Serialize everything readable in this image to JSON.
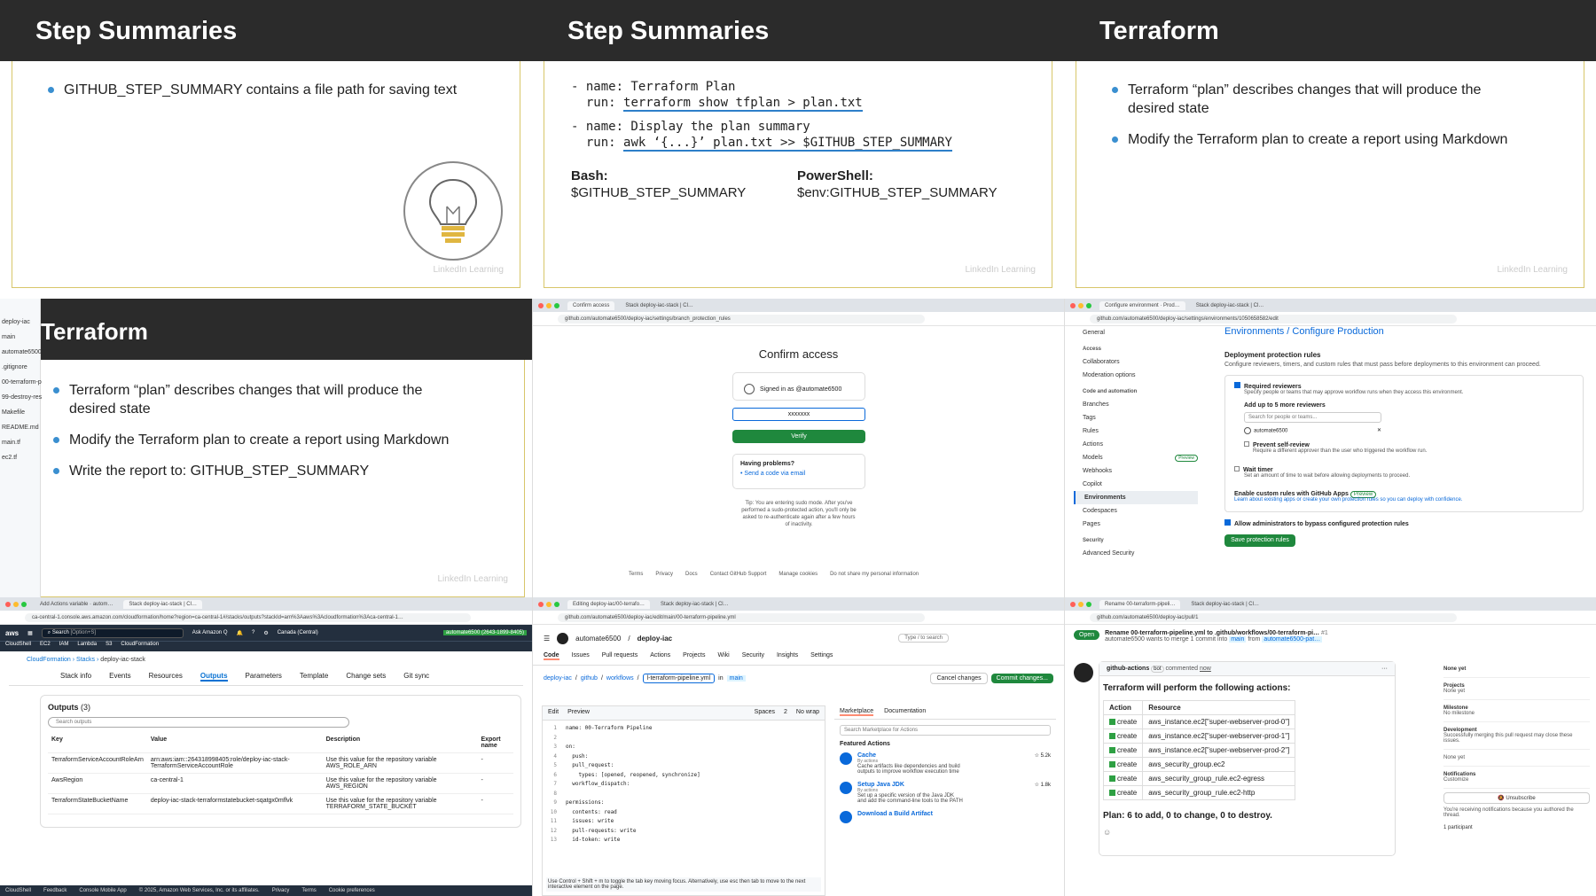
{
  "p1": {
    "title": "Step Summaries",
    "bullets": [
      "GITHUB_STEP_SUMMARY contains a file path for saving text"
    ]
  },
  "p2": {
    "title": "Step Summaries",
    "code": [
      [
        "- name: Terraform Plan",
        "  run: ",
        "terraform show tfplan > plan.txt"
      ],
      [
        "- name: Display the plan summary",
        "  run: ",
        "awk ‘{...}’ plan.txt >> $GITHUB_STEP_SUMMARY"
      ]
    ],
    "bash_label": "Bash:",
    "bash_value": "$GITHUB_STEP_SUMMARY",
    "ps_label": "PowerShell:",
    "ps_value": "$env:GITHUB_STEP_SUMMARY"
  },
  "p3": {
    "title": "Terraform",
    "bullets": [
      "Terraform “plan” describes changes that will produce the desired state",
      "Modify the Terraform plan to create a report using Markdown"
    ]
  },
  "p4": {
    "title": "Terraform",
    "bullets": [
      "Terraform “plan” describes changes that will produce the desired state",
      "Modify the Terraform plan to create a report using Markdown",
      "Write the report to: GITHUB_STEP_SUMMARY"
    ],
    "left_items": [
      "deploy-iac",
      "main",
      "automate6500",
      ".gitignore",
      "00-terraform-p",
      "99-destroy-res",
      "Makefile",
      "README.md",
      "main.tf",
      "ec2.tf"
    ]
  },
  "p5": {
    "tab": "Confirm access",
    "tab2": "Stack deploy-iac-stack | Cl…",
    "url": "github.com/automate6500/deploy-iac/settings/branch_protection_rules",
    "heading": "Confirm access",
    "signed_in": "Signed in as @automate6500",
    "password": "xxxxxxx",
    "verify": "Verify",
    "problems": "Having problems?",
    "send_code": "Send a code via email",
    "tip": "Tip: You are entering sudo mode. After you've performed a sudo-protected action, you'll only be asked to re-authenticate again after a few hours of inactivity.",
    "footer": [
      "Terms",
      "Privacy",
      "Docs",
      "Contact GitHub Support",
      "Manage cookies",
      "Do not share my personal information"
    ]
  },
  "p6": {
    "tab": "Configure environment · Prod…",
    "tab2": "Stack deploy-iac-stack | Cl…",
    "url": "github.com/automate6500/deploy-iac/settings/environments/1050658582/edit",
    "breadcrumb": "Environments / Configure Production",
    "sidebar": [
      "General",
      "Access",
      "Collaborators",
      "Moderation options",
      "Code and automation",
      "Branches",
      "Tags",
      "Rules",
      "Actions",
      "Models",
      "Webhooks",
      "Copilot",
      "Environments",
      "Codespaces",
      "Pages",
      "Security",
      "Advanced Security"
    ],
    "rules_title": "Deployment protection rules",
    "rules_desc": "Configure reviewers, timers, and custom rules that must pass before deployments to this environment can proceed.",
    "req_reviewers": "Required reviewers",
    "req_desc": "Specify people or teams that may approve workflow runs when they access this environment.",
    "add_more": "Add up to 5 more reviewers",
    "search_ph": "Search for people or teams...",
    "reviewer": "automate6500",
    "self_review": "Prevent self-review",
    "self_desc": "Require a different approver than the user who triggered the workflow run.",
    "wait": "Wait timer",
    "wait_desc": "Set an amount of time to wait before allowing deployments to proceed.",
    "custom": "Enable custom rules with GitHub Apps",
    "preview": "Preview",
    "custom_desc": "Learn about existing apps or create your own protection rules so you can deploy with confidence.",
    "bypass": "Allow administrators to bypass configured protection rules",
    "save": "Save protection rules"
  },
  "p7": {
    "tab": "Add Actions variable · autom…",
    "tab2": "Stack deploy-iac-stack | Cl…",
    "url": "ca-central-1.console.aws.amazon.com/cloudformation/home?region=ca-central-1#/stacks/outputs?stackId=arn%3Aaws%3Acloudformation%3Aca-central-1…",
    "search": "Search",
    "search_hint": "[Option+S]",
    "ask": "Ask Amazon Q",
    "region": "Canada (Central)",
    "account": "automate6500 (2643-1899-8405)",
    "console": "console",
    "services": [
      "CloudShell",
      "EC2",
      "IAM",
      "Lambda",
      "S3",
      "CloudFormation"
    ],
    "breadcrumb": [
      "CloudFormation",
      "Stacks",
      "deploy-iac-stack"
    ],
    "tabs": [
      "Stack info",
      "Events",
      "Resources",
      "Outputs",
      "Parameters",
      "Template",
      "Change sets",
      "Git sync"
    ],
    "outputs_title": "Outputs",
    "outputs_count": "(3)",
    "search_outputs": "Search outputs",
    "page": "1",
    "headers": [
      "Key",
      "Value",
      "Description",
      "Export name"
    ],
    "rows": [
      [
        "TerraformServiceAccountRoleArn",
        "arn:aws:iam::264318998405:role/deploy-iac-stack-TerraformServiceAccountRole",
        "Use this value for the repository variable AWS_ROLE_ARN",
        "-"
      ],
      [
        "AwsRegion",
        "ca-central-1",
        "Use this value for the repository variable AWS_REGION",
        "-"
      ],
      [
        "TerraformStateBucketName",
        "deploy-iac-stack-terraformstatebucket-sqatgx0mflvk",
        "Use this value for the repository variable TERRAFORM_STATE_BUCKET",
        "-"
      ]
    ],
    "footer": [
      "CloudShell",
      "Feedback",
      "Console Mobile App",
      "© 2025, Amazon Web Services, Inc. or its affiliates.",
      "Privacy",
      "Terms",
      "Cookie preferences"
    ]
  },
  "p8": {
    "tab": "Editing deploy-iac/00-terrafo…",
    "tab2": "Stack deploy-iac-stack | Cl…",
    "url": "github.com/automate6500/deploy-iac/edit/main/00-terraform-pipeline.yml",
    "owner": "automate6500",
    "repo": "deploy-iac",
    "search": "Type / to search",
    "nav": [
      "Code",
      "Issues",
      "Pull requests",
      "Actions",
      "Projects",
      "Wiki",
      "Security",
      "Insights",
      "Settings"
    ],
    "path": [
      "deploy-iac",
      "github",
      "workflows"
    ],
    "filename": "l-terraform-pipeline.yml",
    "branch": "main",
    "in": "in",
    "cancel": "Cancel changes",
    "commit": "Commit changes...",
    "edit": "Edit",
    "preview": "Preview",
    "spaces": "Spaces",
    "indent": "2",
    "wrap": "No wrap",
    "code": [
      "name: 00-Terraform Pipeline",
      "",
      "on:",
      "  push:",
      "  pull_request:",
      "    types: [opened, reopened, synchronize]",
      "  workflow_dispatch:",
      "",
      "permissions:",
      "  contents: read",
      "  issues: write",
      "  pull-requests: write",
      "  id-token: write"
    ],
    "hint": "Use Control + Shift + m to toggle the tab key moving focus. Alternatively, use esc then tab to move to the next interactive element on the page.",
    "mk_tab": "Marketplace",
    "doc_tab": "Documentation",
    "mk_search": "Search Marketplace for Actions",
    "featured": "Featured Actions",
    "actions": [
      {
        "name": "Cache",
        "by": "By actions",
        "desc": "Cache artifacts like dependencies and build outputs to improve workflow execution time",
        "stars": "5.2k"
      },
      {
        "name": "Setup Java JDK",
        "by": "By actions",
        "desc": "Set up a specific version of the Java JDK and add the command-line tools to the PATH",
        "stars": "1.8k"
      },
      {
        "name": "Download a Build Artifact",
        "by": "",
        "desc": "",
        "stars": ""
      }
    ]
  },
  "p9": {
    "tab": "Rename 00-terraform-pipeli…",
    "tab2": "Stack deploy-iac-stack | Cl…",
    "url": "github.com/automate6500/deploy-iac/pull/1",
    "status": "Open",
    "pr_title": "Rename 00-terraform-pipeline.yml to .github/workflows/00-terraform-pi…",
    "pr_num": "#1",
    "pr_sub": "automate6500 wants to merge 1 commit into",
    "base": "main",
    "from": "from",
    "head": "automate6500-pat…",
    "bot": "github-actions",
    "bot_tag": "bot",
    "commented": "commented",
    "now": "now",
    "heading": "Terraform will perform the following actions:",
    "headers": [
      "Action",
      "Resource"
    ],
    "rows": [
      [
        "create",
        "aws_instance.ec2[\"super-webserver-prod-0\"]"
      ],
      [
        "create",
        "aws_instance.ec2[\"super-webserver-prod-1\"]"
      ],
      [
        "create",
        "aws_instance.ec2[\"super-webserver-prod-2\"]"
      ],
      [
        "create",
        "aws_security_group.ec2"
      ],
      [
        "create",
        "aws_security_group_rule.ec2-egress"
      ],
      [
        "create",
        "aws_security_group_rule.ec2-http"
      ]
    ],
    "plan": "Plan: 6 to add, 0 to change, 0 to destroy.",
    "side": [
      {
        "h": "None yet",
        "v": ""
      },
      {
        "h": "Projects",
        "v": "None yet"
      },
      {
        "h": "Milestone",
        "v": "No milestone"
      },
      {
        "h": "Development",
        "v": "Successfully merging this pull request may close these issues."
      },
      {
        "h": "",
        "v": "None yet"
      },
      {
        "h": "Notifications",
        "v": "Customize"
      }
    ],
    "unsub": "Unsubscribe",
    "notif": "You're receiving notifications because you authored the thread.",
    "participants": "1 participant"
  },
  "watermark": "LinkedIn Learning"
}
